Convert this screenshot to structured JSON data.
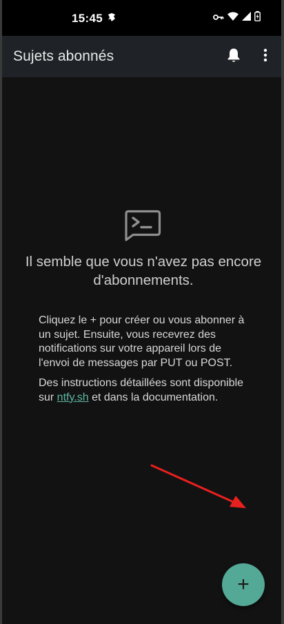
{
  "status_bar": {
    "time": "15:45",
    "icons": [
      "notification-app-icon",
      "vpn-key-icon",
      "wifi-icon",
      "signal-icon",
      "battery-charging-icon"
    ]
  },
  "app_bar": {
    "title": "Sujets abonnés",
    "icons": [
      "bell-icon",
      "more-vert-icon"
    ]
  },
  "empty_state": {
    "icon": "terminal-message-icon",
    "title": "Il semble que vous n'avez pas encore d'abonnements.",
    "paragraph1": "Cliquez le + pour créer ou vous abonner à un sujet. Ensuite, vous recevrez des notifications sur votre appareil lors de l'envoi de messages par PUT ou POST.",
    "paragraph2_before": "Des instructions détaillées sont disponible sur ",
    "paragraph2_link": "ntfy.sh",
    "paragraph2_after": " et dans la documentation."
  },
  "fab": {
    "label": "+"
  },
  "colors": {
    "background": "#121212",
    "app_bar": "#1f2327",
    "accent": "#54a996",
    "link": "#5fb8a5",
    "annotation_arrow": "#e8201f"
  }
}
